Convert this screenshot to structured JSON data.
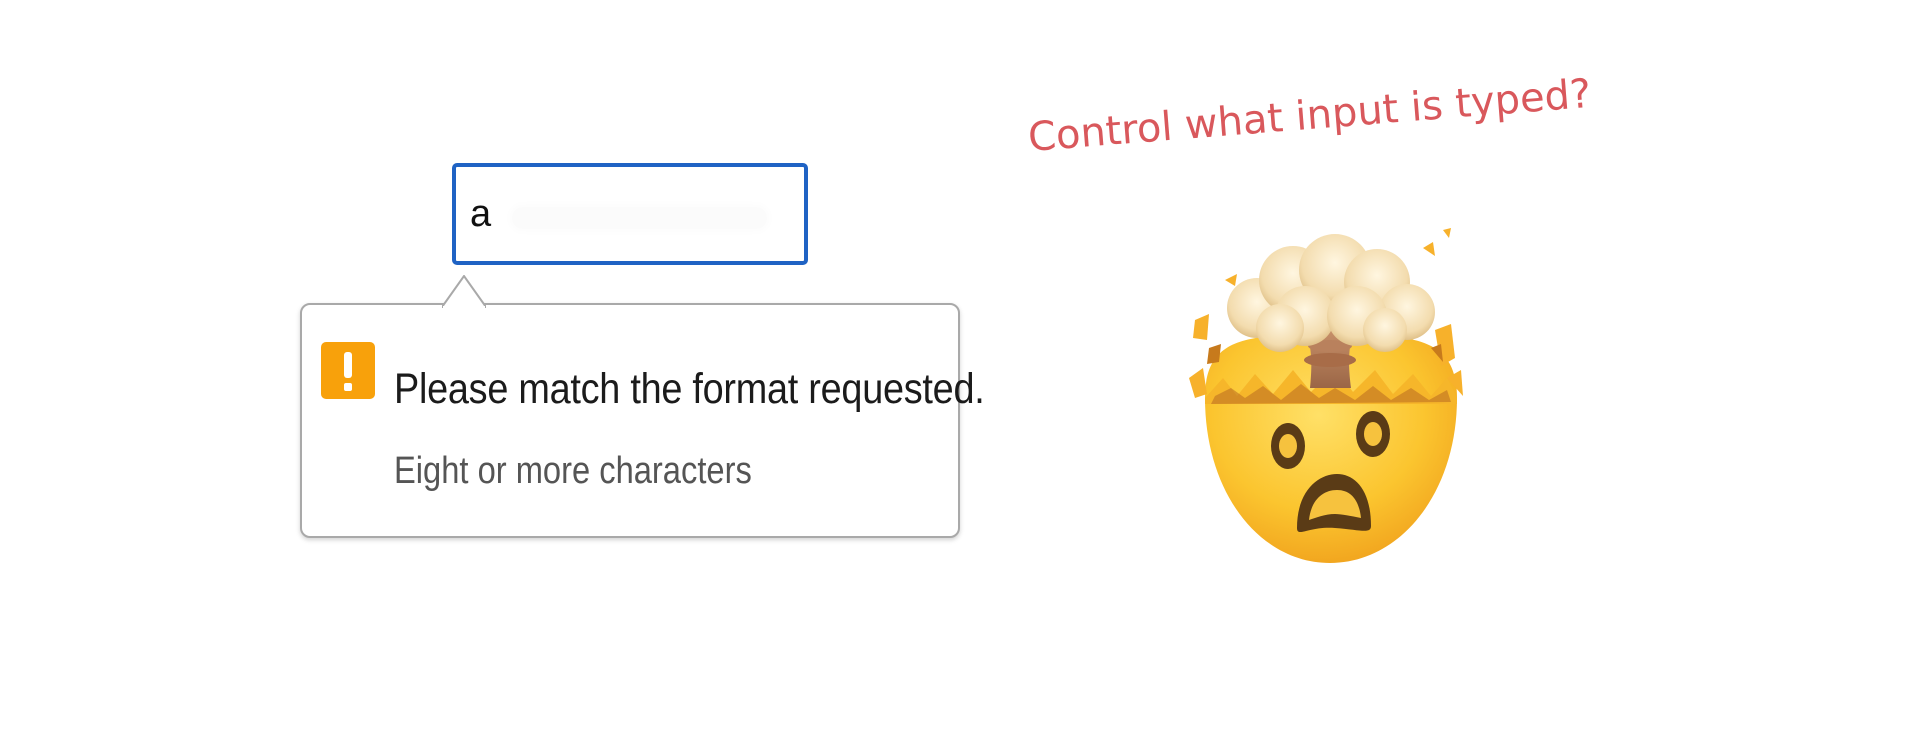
{
  "input": {
    "value": "a"
  },
  "validation": {
    "icon": "exclamation-warning-icon",
    "icon_glyph": "!",
    "message": "Please match the format requested.",
    "hint": "Eight or more characters",
    "icon_color": "#f8a10b",
    "focus_color": "#1f63c4"
  },
  "caption": {
    "text": "Control what input is typed?",
    "color": "#d9585c"
  },
  "emoji": {
    "icon": "exploding-head-emoji-icon"
  }
}
